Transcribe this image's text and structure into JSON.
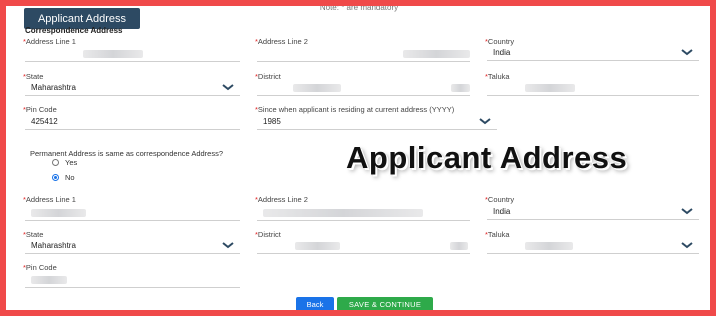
{
  "header": {
    "top_note": "Note: * are mandatory",
    "section_tab": "Applicant Address",
    "subheading": "Correspondence Address"
  },
  "correspondence": {
    "address_line1": {
      "label": "Address Line 1",
      "value": ""
    },
    "address_line2": {
      "label": "Address Line 2",
      "value": ""
    },
    "country": {
      "label": "Country",
      "value": "India"
    },
    "state": {
      "label": "State",
      "value": "Maharashtra"
    },
    "district": {
      "label": "District",
      "value": ""
    },
    "taluka": {
      "label": "Taluka",
      "value": ""
    },
    "pin_code": {
      "label": "Pin Code",
      "value": "425412"
    },
    "residing_since": {
      "label": "Since when applicant is residing at current address (YYYY)",
      "value": "1985"
    }
  },
  "permanent_same": {
    "question": "Permanent Address is same as correspondence Address?",
    "options": [
      {
        "label": "Yes",
        "selected": false
      },
      {
        "label": "No",
        "selected": true
      }
    ]
  },
  "permanent": {
    "address_line1": {
      "label": "Address Line 1",
      "value": ""
    },
    "address_line2": {
      "label": "Address Line 2",
      "value": ""
    },
    "country": {
      "label": "Country",
      "value": "India"
    },
    "state": {
      "label": "State",
      "value": "Maharashtra"
    },
    "district": {
      "label": "District",
      "value": ""
    },
    "taluka": {
      "label": "Taluka",
      "value": ""
    },
    "pin_code": {
      "label": "Pin Code",
      "value": ""
    }
  },
  "overlay_title": "Applicant Address",
  "buttons": {
    "back": "Back",
    "save_continue": "SAVE & CONTINUE"
  },
  "colors": {
    "frame": "#f04a4a",
    "tab": "#2d4a63",
    "back_button": "#1a73e8",
    "save_button": "#2eaa4a",
    "required_star": "#e02020"
  },
  "icons": {
    "dropdown": "chevron-down-icon",
    "radio": "radio-icon"
  }
}
